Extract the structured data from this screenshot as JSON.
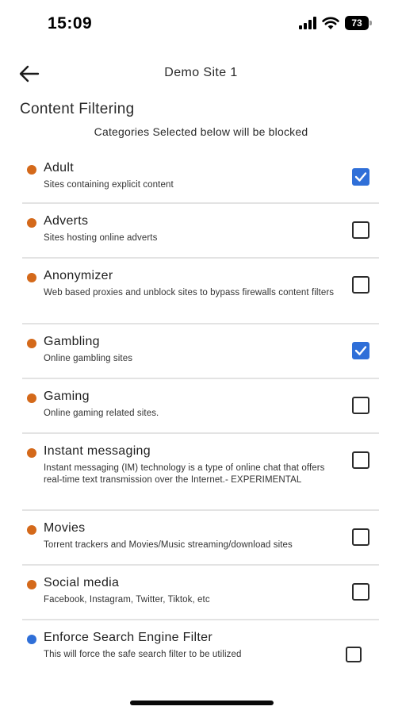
{
  "status_bar": {
    "time": "15:09",
    "battery": "73"
  },
  "header": {
    "title": "Demo Site 1",
    "back_icon": "arrow-left-icon"
  },
  "content": {
    "title": "Content Filtering",
    "subtitle": "Categories Selected below will be blocked"
  },
  "colors": {
    "category_dot": "#d4691a",
    "search_filter_dot": "#2f6fd8",
    "checked": "#2f6fd8"
  },
  "categories": [
    {
      "name": "Adult",
      "description": "Sites containing explicit content",
      "checked": true,
      "dot_color": "#d4691a"
    },
    {
      "name": "Adverts",
      "description": "Sites hosting online adverts",
      "checked": false,
      "dot_color": "#d4691a"
    },
    {
      "name": "Anonymizer",
      "description": "Web based proxies and unblock sites to bypass firewalls content filters",
      "checked": false,
      "dot_color": "#d4691a"
    },
    {
      "name": "Gambling",
      "description": "Online gambling sites",
      "checked": true,
      "dot_color": "#d4691a"
    },
    {
      "name": "Gaming",
      "description": "Online gaming related sites.",
      "checked": false,
      "dot_color": "#d4691a"
    },
    {
      "name": "Instant messaging",
      "description": "Instant messaging (IM) technology is a type of online chat that offers real-time text transmission over the Internet.- EXPERIMENTAL",
      "checked": false,
      "dot_color": "#d4691a"
    },
    {
      "name": "Movies",
      "description": "Torrent trackers and Movies/Music streaming/download sites",
      "checked": false,
      "dot_color": "#d4691a"
    },
    {
      "name": "Social media",
      "description": "Facebook, Instagram, Twitter, Tiktok, etc",
      "checked": false,
      "dot_color": "#d4691a"
    },
    {
      "name": "Enforce Search Engine Filter",
      "description": "This will force the safe search filter to be utilized",
      "checked": false,
      "dot_color": "#2f6fd8"
    }
  ]
}
